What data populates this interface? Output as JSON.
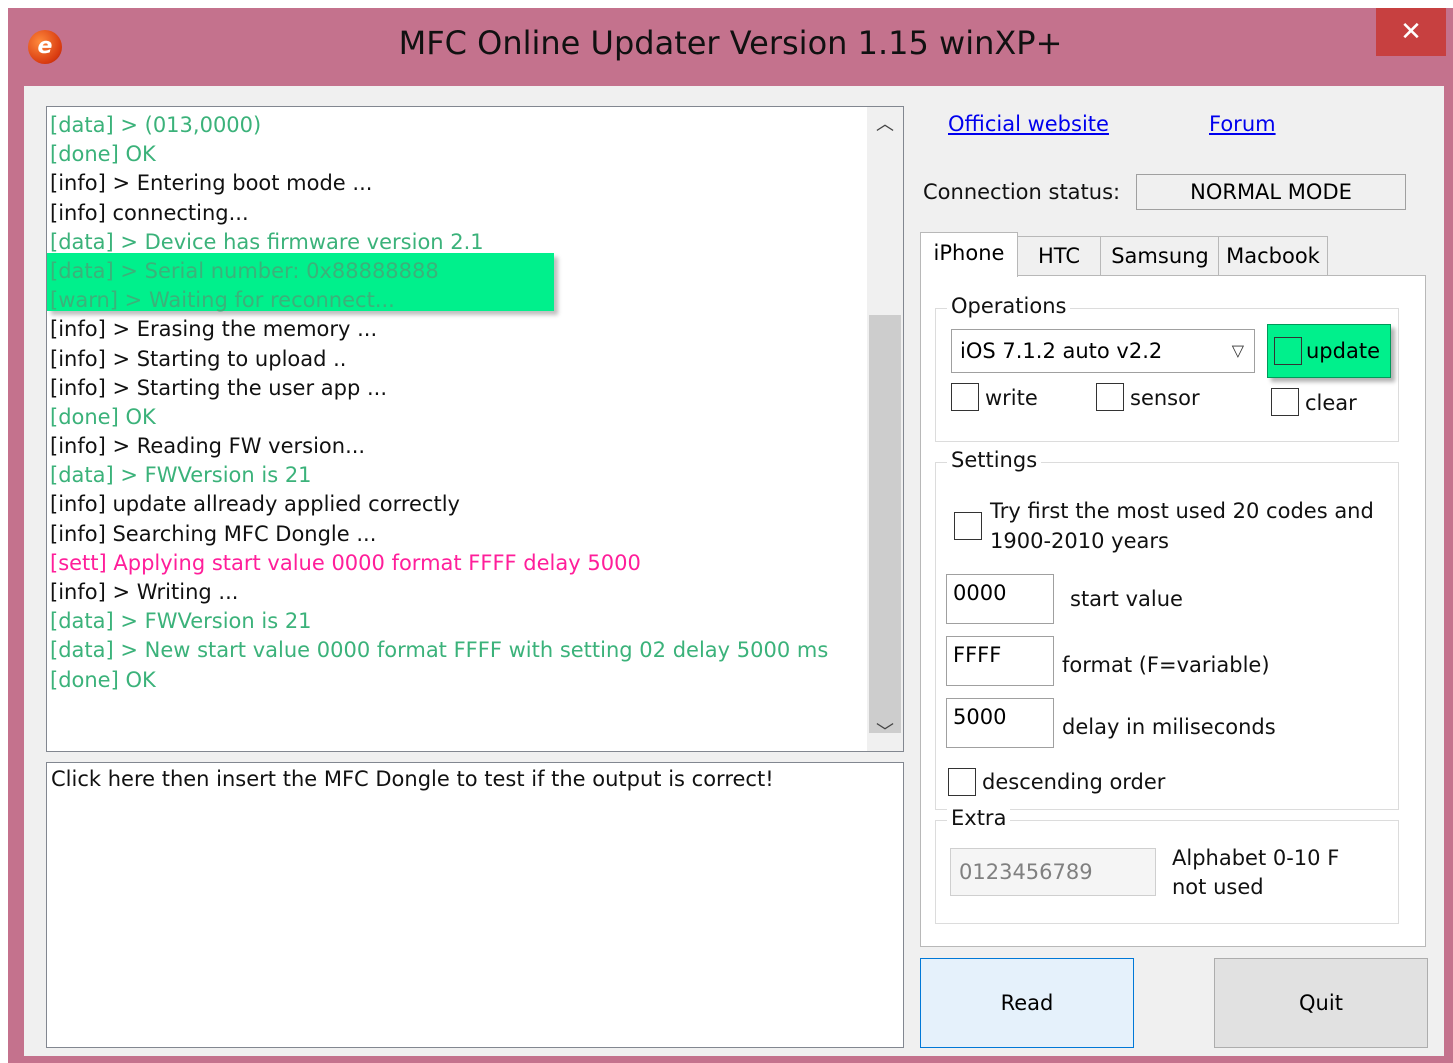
{
  "window": {
    "title": "MFC Online Updater Version 1.15 winXP+",
    "close_label": "✕"
  },
  "log": {
    "lines": [
      {
        "text": "[data] >  (013,0000)",
        "color": "green"
      },
      {
        "text": "[done] OK",
        "color": "green"
      },
      {
        "text": "[info] > Entering boot mode ...",
        "color": "black"
      },
      {
        "text": "[info] connecting...",
        "color": "black"
      },
      {
        "text": "[data] > Device has firmware version 2.1",
        "color": "green"
      },
      {
        "text": "[data] > Serial number: 0x88888888",
        "color": "green"
      },
      {
        "text": "[warn] > Waiting for reconnect...",
        "color": "green"
      },
      {
        "text": "[info] > Erasing the memory ...",
        "color": "black"
      },
      {
        "text": "[info] > Starting to upload ..",
        "color": "black"
      },
      {
        "text": "[info] > Starting the user app ...",
        "color": "black"
      },
      {
        "text": "[done] OK",
        "color": "green"
      },
      {
        "text": "[info] > Reading FW version...",
        "color": "black"
      },
      {
        "text": "[data] > FWVersion is 21",
        "color": "green"
      },
      {
        "text": "[info] update allready applied correctly",
        "color": "black"
      },
      {
        "text": "[info] Searching MFC Dongle ...",
        "color": "black"
      },
      {
        "text": "[sett] Applying start value 0000 format FFFF delay 5000",
        "color": "pink"
      },
      {
        "text": "[info] > Writing ...",
        "color": "black"
      },
      {
        "text": "[data] > FWVersion is 21",
        "color": "green"
      },
      {
        "text": "[data] > New start value 0000 format FFFF with setting 02 delay 5000 ms",
        "color": "green"
      },
      {
        "text": "[done] OK",
        "color": "green"
      }
    ]
  },
  "test_box": {
    "text": "Click here then insert the MFC Dongle to test if the output is correct!"
  },
  "links": {
    "official": "Official website",
    "forum": "Forum"
  },
  "connection": {
    "label": "Connection status:",
    "value": "NORMAL MODE"
  },
  "tabs": [
    "iPhone",
    "HTC",
    "Samsung",
    "Macbook"
  ],
  "operations": {
    "title": "Operations",
    "selected": "iOS 7.1.2 auto v2.2",
    "update_label": "update",
    "write_label": "write",
    "sensor_label": "sensor",
    "clear_label": "clear"
  },
  "settings": {
    "title": "Settings",
    "try_first_line1": "Try first the most used 20 codes and",
    "try_first_line2": "1900-2010 years",
    "start_value": "0000",
    "start_label": "start value",
    "format_value": "FFFF",
    "format_label": "format (F=variable)",
    "delay_value": "5000",
    "delay_label": "delay in miliseconds",
    "descending_label": "descending order"
  },
  "extra": {
    "title": "Extra",
    "alphabet_value": "0123456789",
    "alphabet_label_line1": "Alphabet 0-10 F",
    "alphabet_label_line2": "not used"
  },
  "buttons": {
    "read": "Read",
    "quit": "Quit"
  },
  "colors": {
    "title_bar": "#c4728d",
    "close": "#c74040",
    "highlight": "#00f08c",
    "log_green": "#3bb27a",
    "log_pink": "#ff1e9a",
    "link": "#0000ee"
  }
}
